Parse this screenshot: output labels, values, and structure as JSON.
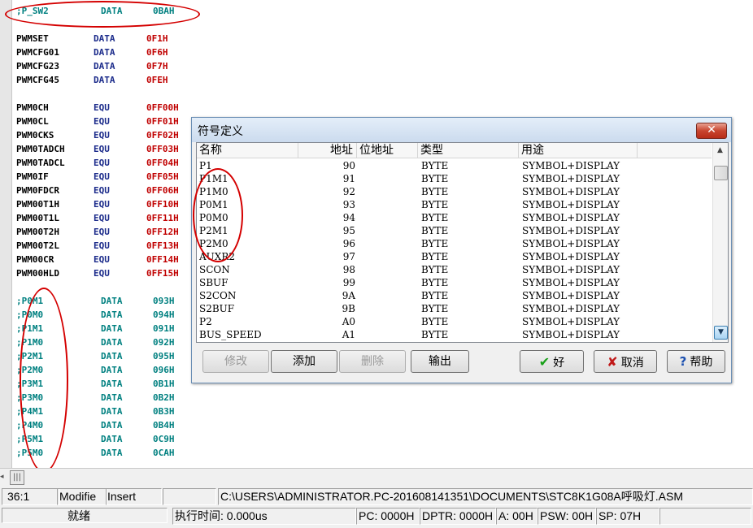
{
  "editor": {
    "lines": [
      {
        "sym": ";P_SW2",
        "kw": "DATA",
        "val": "0BAH",
        "style": "comment"
      },
      {
        "sym": "",
        "kw": "",
        "val": "",
        "style": "normal"
      },
      {
        "sym": "PWMSET",
        "kw": "DATA",
        "val": "0F1H",
        "style": "normal"
      },
      {
        "sym": "PWMCFG01",
        "kw": "DATA",
        "val": "0F6H",
        "style": "normal"
      },
      {
        "sym": "PWMCFG23",
        "kw": "DATA",
        "val": "0F7H",
        "style": "normal"
      },
      {
        "sym": "PWMCFG45",
        "kw": "DATA",
        "val": "0FEH",
        "style": "normal"
      },
      {
        "sym": "",
        "kw": "",
        "val": "",
        "style": "normal"
      },
      {
        "sym": "PWM0CH",
        "kw": "EQU",
        "val": "0FF00H",
        "style": "normal"
      },
      {
        "sym": "PWM0CL",
        "kw": "EQU",
        "val": "0FF01H",
        "style": "normal"
      },
      {
        "sym": "PWM0CKS",
        "kw": "EQU",
        "val": "0FF02H",
        "style": "normal"
      },
      {
        "sym": "PWM0TADCH",
        "kw": "EQU",
        "val": "0FF03H",
        "style": "normal"
      },
      {
        "sym": "PWM0TADCL",
        "kw": "EQU",
        "val": "0FF04H",
        "style": "normal"
      },
      {
        "sym": "PWM0IF",
        "kw": "EQU",
        "val": "0FF05H",
        "style": "normal"
      },
      {
        "sym": "PWM0FDCR",
        "kw": "EQU",
        "val": "0FF06H",
        "style": "normal"
      },
      {
        "sym": "PWM00T1H",
        "kw": "EQU",
        "val": "0FF10H",
        "style": "normal"
      },
      {
        "sym": "PWM00T1L",
        "kw": "EQU",
        "val": "0FF11H",
        "style": "normal"
      },
      {
        "sym": "PWM00T2H",
        "kw": "EQU",
        "val": "0FF12H",
        "style": "normal"
      },
      {
        "sym": "PWM00T2L",
        "kw": "EQU",
        "val": "0FF13H",
        "style": "normal"
      },
      {
        "sym": "PWM00CR",
        "kw": "EQU",
        "val": "0FF14H",
        "style": "normal"
      },
      {
        "sym": "PWM00HLD",
        "kw": "EQU",
        "val": "0FF15H",
        "style": "normal"
      },
      {
        "sym": "",
        "kw": "",
        "val": "",
        "style": "normal"
      },
      {
        "sym": ";P0M1",
        "kw": "DATA",
        "val": "093H",
        "style": "comment"
      },
      {
        "sym": ";P0M0",
        "kw": "DATA",
        "val": "094H",
        "style": "comment"
      },
      {
        "sym": ";P1M1",
        "kw": "DATA",
        "val": "091H",
        "style": "comment"
      },
      {
        "sym": ";P1M0",
        "kw": "DATA",
        "val": "092H",
        "style": "comment"
      },
      {
        "sym": ";P2M1",
        "kw": "DATA",
        "val": "095H",
        "style": "comment"
      },
      {
        "sym": ";P2M0",
        "kw": "DATA",
        "val": "096H",
        "style": "comment"
      },
      {
        "sym": ";P3M1",
        "kw": "DATA",
        "val": "0B1H",
        "style": "comment"
      },
      {
        "sym": ";P3M0",
        "kw": "DATA",
        "val": "0B2H",
        "style": "comment"
      },
      {
        "sym": ";P4M1",
        "kw": "DATA",
        "val": "0B3H",
        "style": "comment"
      },
      {
        "sym": ";P4M0",
        "kw": "DATA",
        "val": "0B4H",
        "style": "comment"
      },
      {
        "sym": ";P5M1",
        "kw": "DATA",
        "val": "0C9H",
        "style": "comment"
      },
      {
        "sym": ";P5M0",
        "kw": "DATA",
        "val": "0CAH",
        "style": "comment"
      }
    ]
  },
  "status1": {
    "position": "36:1",
    "modified": "Modifie",
    "mode": "Insert",
    "path": "C:\\USERS\\ADMINISTRATOR.PC-201608141351\\DOCUMENTS\\STC8K1G08A呼吸灯.ASM"
  },
  "status2": {
    "ready": "就绪",
    "exec_time": "执行时间: 0.000us",
    "pc": "PC: 0000H",
    "dptr": "DPTR: 0000H",
    "a": "A: 00H",
    "psw": "PSW: 00H",
    "sp": "SP: 07H"
  },
  "dialog": {
    "title": "符号定义",
    "close_glyph": "✕",
    "columns": {
      "name": "名称",
      "addr": "地址",
      "bitaddr": "位地址",
      "type": "类型",
      "use": "用途"
    },
    "rows": [
      {
        "name": "P1",
        "addr": "90",
        "type": "BYTE",
        "use": "SYMBOL+DISPLAY"
      },
      {
        "name": "P1M1",
        "addr": "91",
        "type": "BYTE",
        "use": "SYMBOL+DISPLAY"
      },
      {
        "name": "P1M0",
        "addr": "92",
        "type": "BYTE",
        "use": "SYMBOL+DISPLAY"
      },
      {
        "name": "P0M1",
        "addr": "93",
        "type": "BYTE",
        "use": "SYMBOL+DISPLAY"
      },
      {
        "name": "P0M0",
        "addr": "94",
        "type": "BYTE",
        "use": "SYMBOL+DISPLAY"
      },
      {
        "name": "P2M1",
        "addr": "95",
        "type": "BYTE",
        "use": "SYMBOL+DISPLAY"
      },
      {
        "name": "P2M0",
        "addr": "96",
        "type": "BYTE",
        "use": "SYMBOL+DISPLAY"
      },
      {
        "name": "AUXR2",
        "addr": "97",
        "type": "BYTE",
        "use": "SYMBOL+DISPLAY"
      },
      {
        "name": "SCON",
        "addr": "98",
        "type": "BYTE",
        "use": "SYMBOL+DISPLAY"
      },
      {
        "name": "SBUF",
        "addr": "99",
        "type": "BYTE",
        "use": "SYMBOL+DISPLAY"
      },
      {
        "name": "S2CON",
        "addr": "9A",
        "type": "BYTE",
        "use": "SYMBOL+DISPLAY"
      },
      {
        "name": "S2BUF",
        "addr": "9B",
        "type": "BYTE",
        "use": "SYMBOL+DISPLAY"
      },
      {
        "name": "P2",
        "addr": "A0",
        "type": "BYTE",
        "use": "SYMBOL+DISPLAY"
      },
      {
        "name": "BUS_SPEED",
        "addr": "A1",
        "type": "BYTE",
        "use": "SYMBOL+DISPLAY"
      }
    ],
    "buttons": {
      "modify": "修改",
      "add": "添加",
      "delete": "删除",
      "output": "输出",
      "ok": "好",
      "cancel": "取消",
      "help": "帮助"
    }
  }
}
